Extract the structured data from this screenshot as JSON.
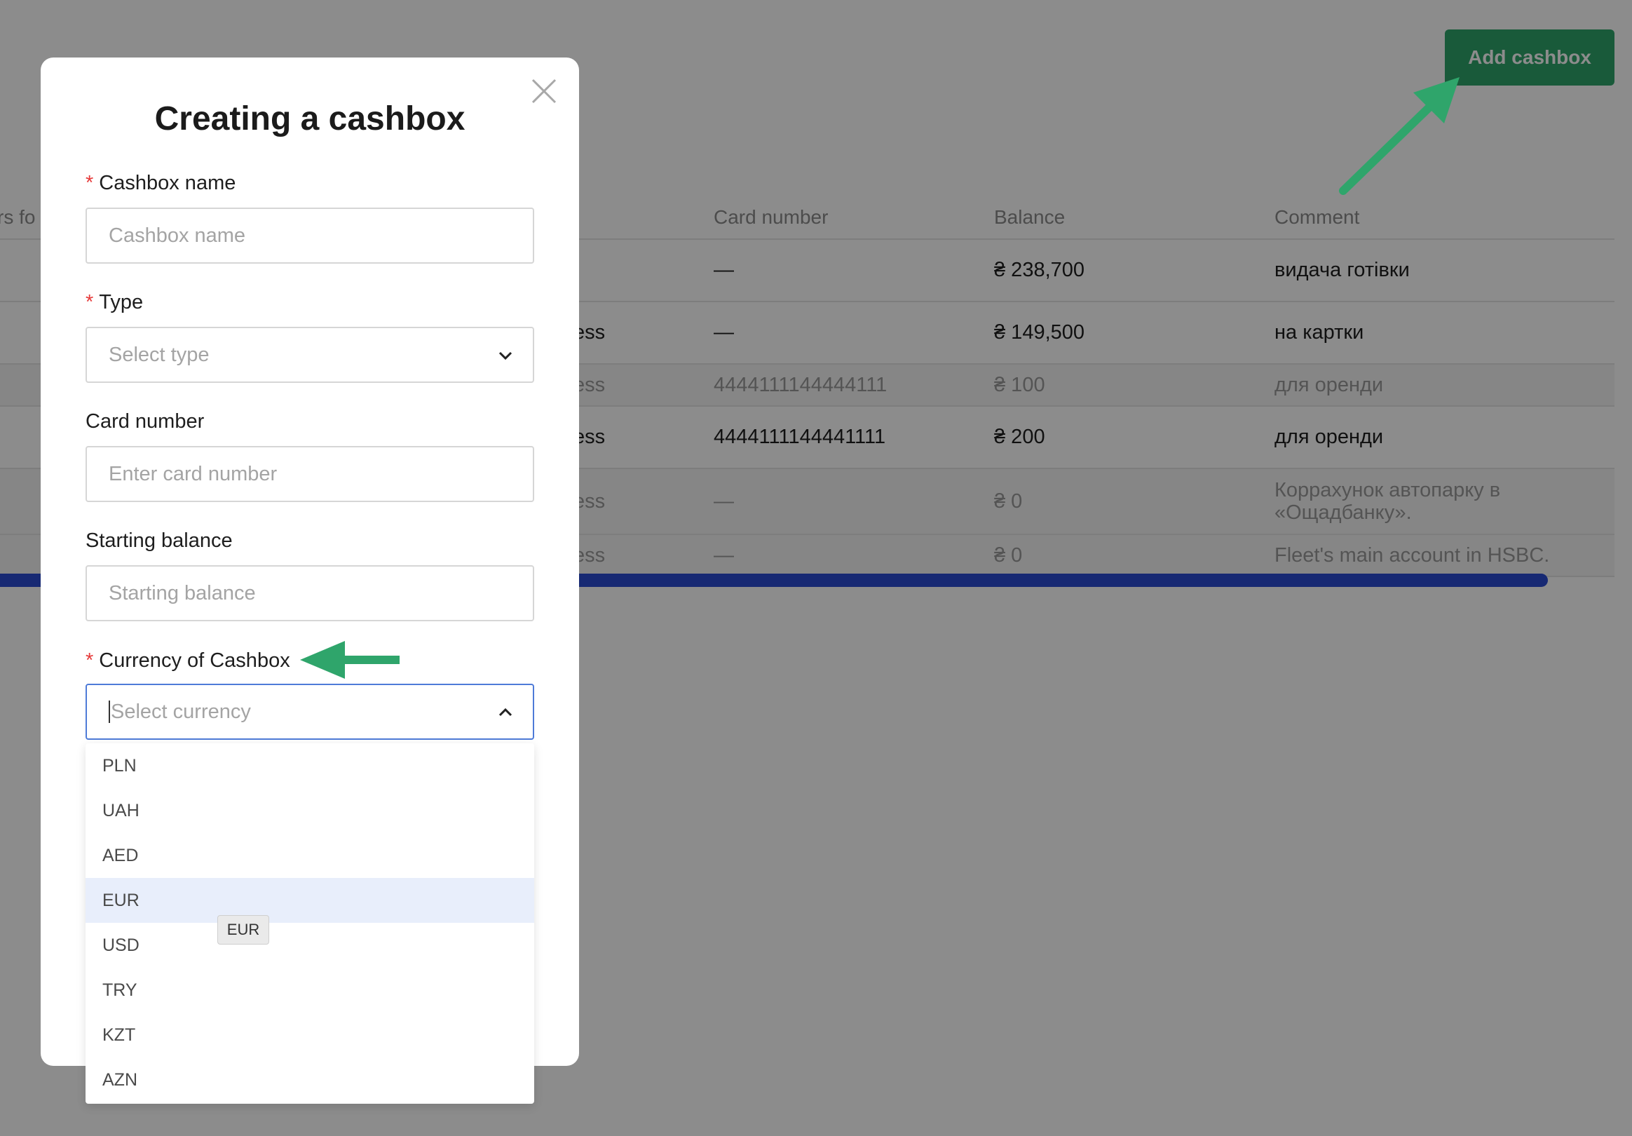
{
  "page": {
    "add_cashbox_label": "Add cashbox"
  },
  "table": {
    "headers": [
      "rs fo",
      "Card number",
      "Balance",
      "Comment"
    ],
    "rows": [
      {
        "type": "",
        "card": "—",
        "balance": "₴ 238,700",
        "comment": "видача готівки"
      },
      {
        "type": "ess",
        "card": "—",
        "balance": "₴ 149,500",
        "comment": "на картки"
      },
      {
        "type": "ess",
        "card": "4444111144444111",
        "balance": "₴ 100",
        "comment": "для оренди"
      },
      {
        "type": "ess",
        "card": "4444111144441111",
        "balance": "₴ 200",
        "comment": "для оренди"
      },
      {
        "type": "ess",
        "card": "—",
        "balance": "₴ 0",
        "comment": "Коррахунок автопарку в «Ощадбанку»."
      },
      {
        "type": "ess",
        "card": "—",
        "balance": "₴ 0",
        "comment": "Fleet's main account in HSBC."
      }
    ]
  },
  "modal": {
    "title": "Creating a cashbox",
    "required_mark": "*",
    "fields": {
      "name": {
        "label": "Cashbox name",
        "placeholder": "Cashbox name"
      },
      "type": {
        "label": "Type",
        "placeholder": "Select type"
      },
      "card": {
        "label": "Card number",
        "placeholder": "Enter card number"
      },
      "balance": {
        "label": "Starting balance",
        "placeholder": "Starting balance"
      },
      "currency": {
        "label": "Currency of Cashbox",
        "placeholder": "Select currency"
      }
    },
    "currency_options": [
      "PLN",
      "UAH",
      "AED",
      "EUR",
      "USD",
      "TRY",
      "KZT",
      "AZN"
    ],
    "highlighted_option": "EUR",
    "tooltip": "EUR"
  },
  "colors": {
    "accent_green": "#2fa56b",
    "annotation_arrow": "#2fa56b",
    "focus_blue": "#4e7bd8",
    "scrollbar_blue": "#2a4bd2",
    "required_red": "#e63b3b"
  },
  "icons": [
    "close-icon",
    "chevron-down-icon",
    "chevron-up-icon",
    "annotation-arrow-icon"
  ]
}
